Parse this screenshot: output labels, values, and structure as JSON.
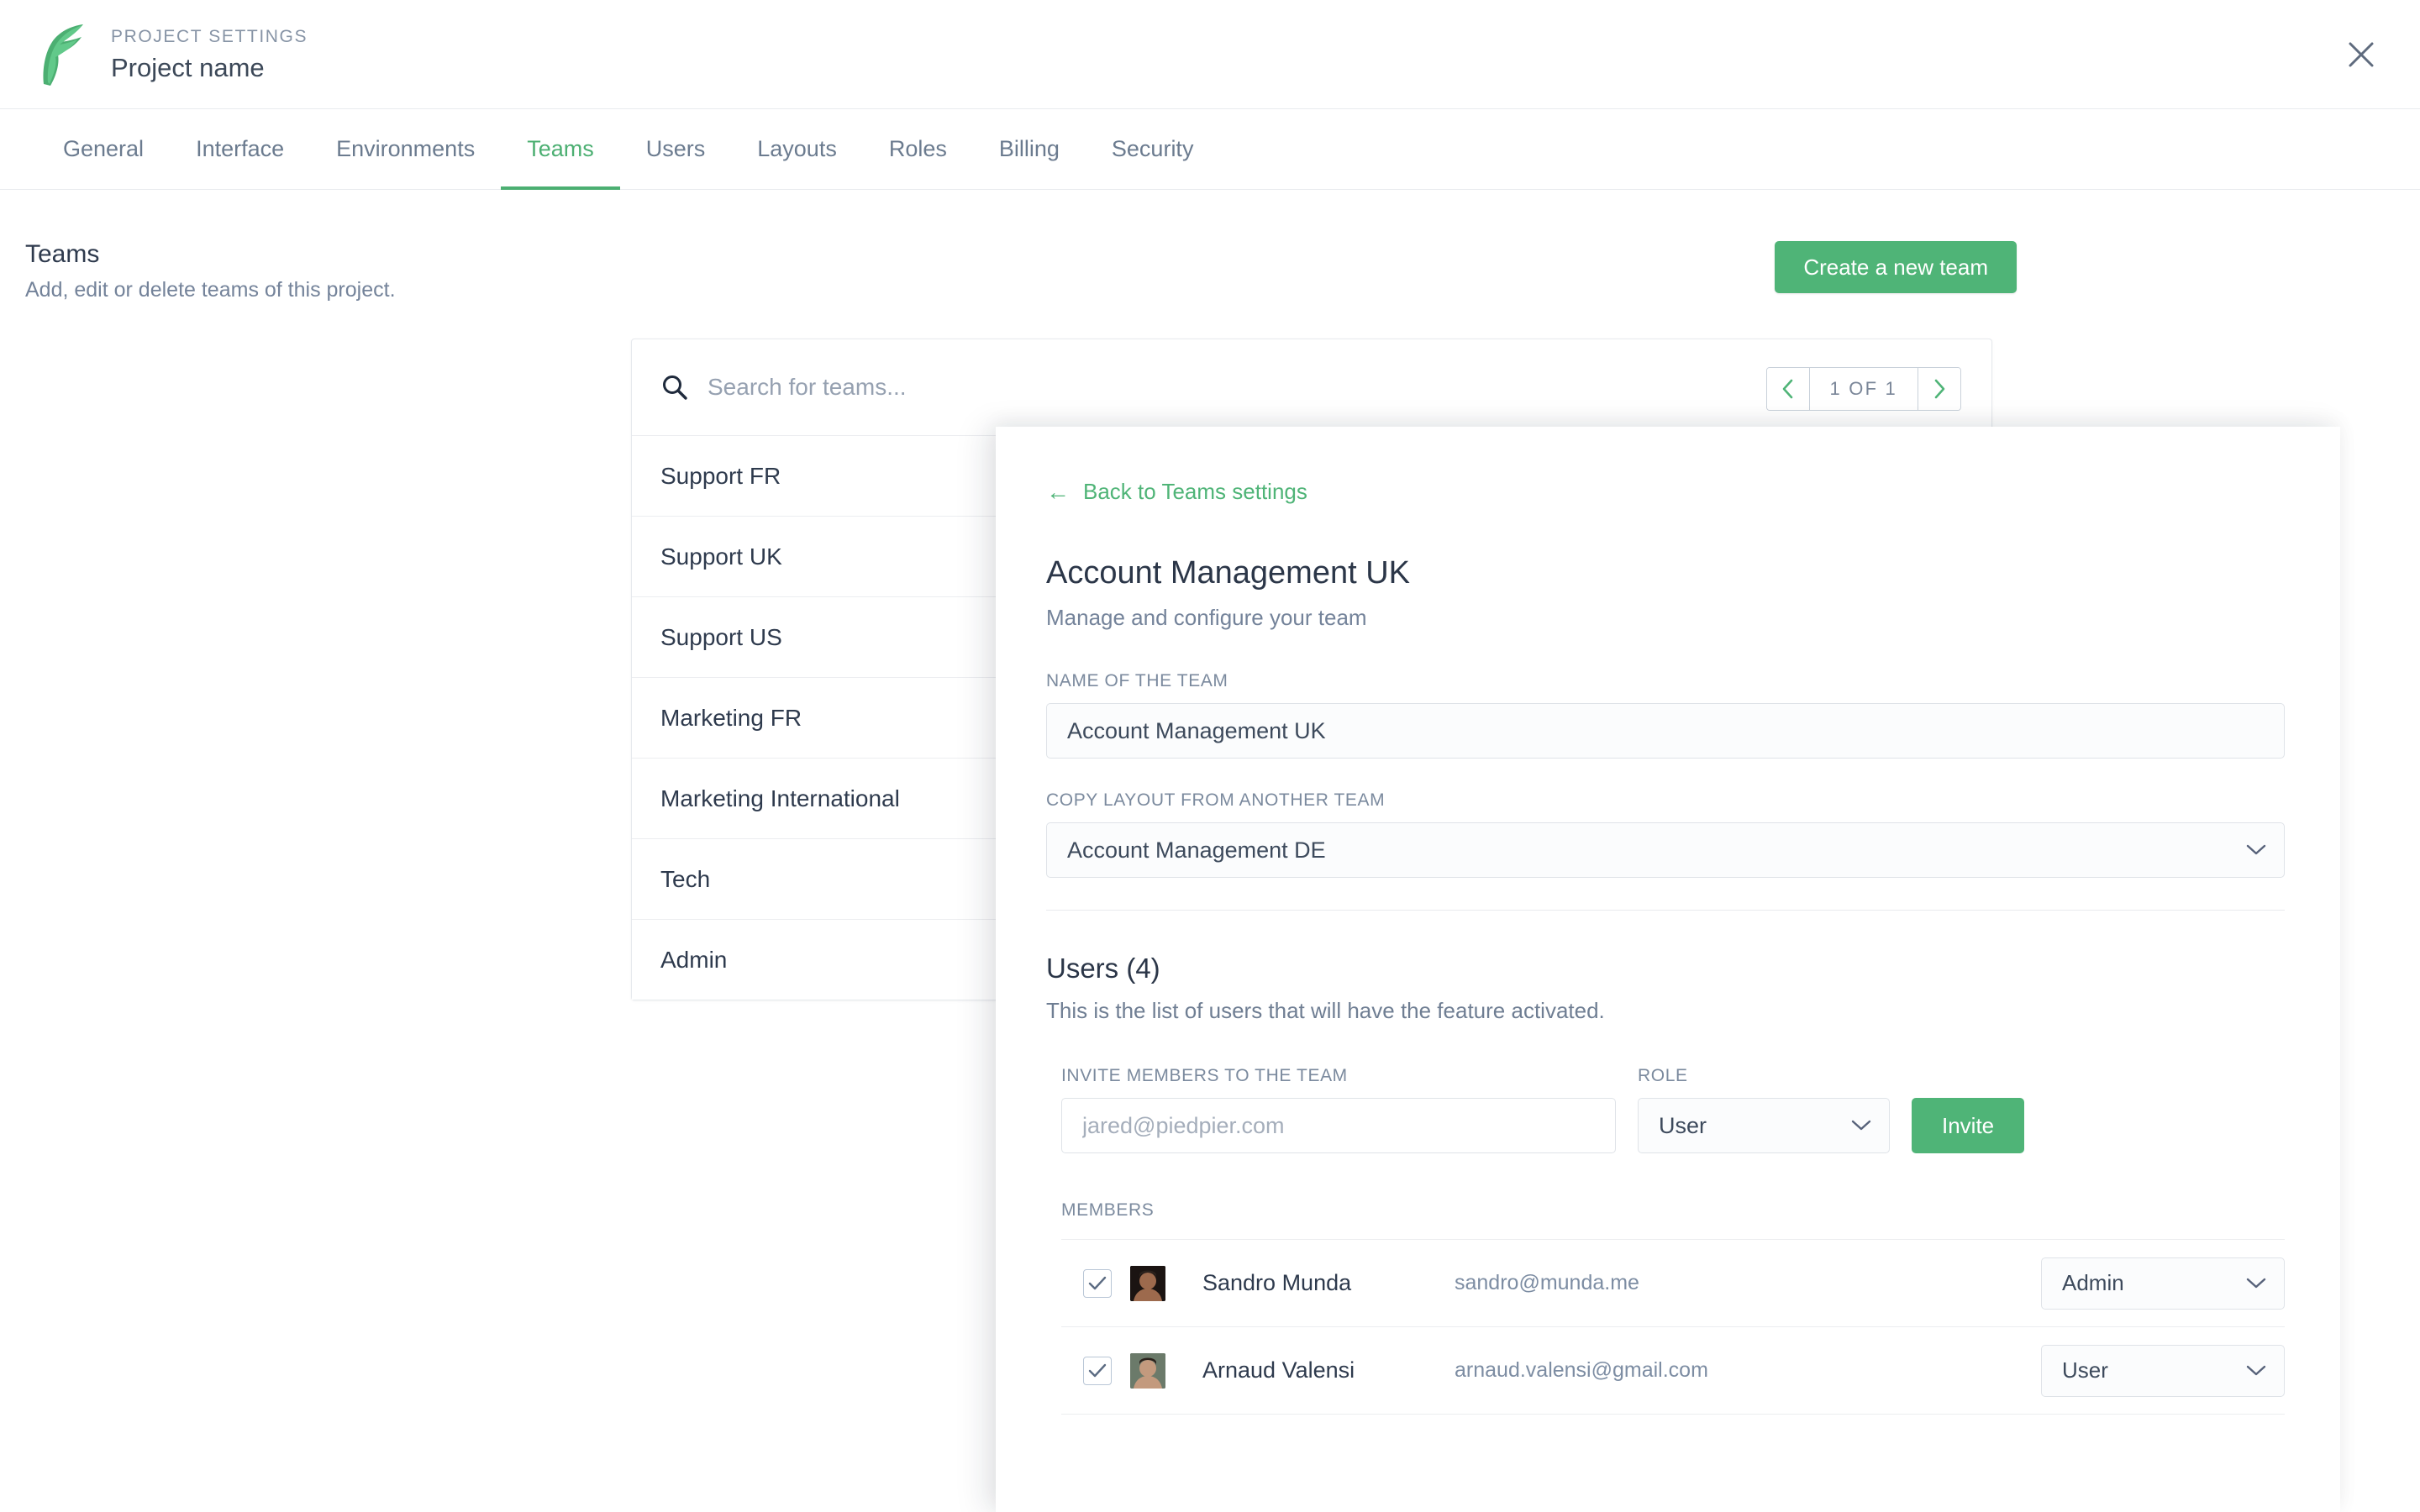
{
  "header": {
    "kicker": "PROJECT SETTINGS",
    "title": "Project name",
    "close_label": "×"
  },
  "tabs": [
    {
      "label": "General",
      "active": false
    },
    {
      "label": "Interface",
      "active": false
    },
    {
      "label": "Environments",
      "active": false
    },
    {
      "label": "Teams",
      "active": true
    },
    {
      "label": "Users",
      "active": false
    },
    {
      "label": "Layouts",
      "active": false
    },
    {
      "label": "Roles",
      "active": false
    },
    {
      "label": "Billing",
      "active": false
    },
    {
      "label": "Security",
      "active": false
    }
  ],
  "page": {
    "title": "Teams",
    "subtitle": "Add, edit or delete teams of this project.",
    "create_button": "Create a new team"
  },
  "teams_card": {
    "search_placeholder": "Search for teams...",
    "search_value": "",
    "pagination": {
      "label": "1 OF 1",
      "prev": "‹",
      "next": "›"
    },
    "items": [
      {
        "name": "Support FR"
      },
      {
        "name": "Support UK"
      },
      {
        "name": "Support US"
      },
      {
        "name": "Marketing FR"
      },
      {
        "name": "Marketing International"
      },
      {
        "name": "Tech"
      },
      {
        "name": "Admin"
      }
    ]
  },
  "detail": {
    "back_link": "Back to Teams settings",
    "back_arrow": "←",
    "title": "Account Management UK",
    "subtitle": "Manage and configure your team",
    "name_field": {
      "label": "NAME OF THE TEAM",
      "value": "Account Management UK"
    },
    "copy_layout_field": {
      "label": "COPY LAYOUT FROM ANOTHER TEAM",
      "value": "Account Management DE"
    },
    "users": {
      "title": "Users (4)",
      "subtitle": "This is the list of users that will have the feature activated.",
      "invite": {
        "email_label": "INVITE MEMBERS TO THE TEAM",
        "email_placeholder": "jared@piedpier.com",
        "email_value": "",
        "role_label": "ROLE",
        "role_value": "User",
        "button": "Invite"
      },
      "members_label": "MEMBERS",
      "members": [
        {
          "name": "Sandro Munda",
          "email": "sandro@munda.me",
          "role": "Admin",
          "checked": true,
          "avatar_bg": "#1b1412",
          "avatar_skin": "#9d6a4d"
        },
        {
          "name": "Arnaud Valensi",
          "email": "arnaud.valensi@gmail.com",
          "role": "User",
          "checked": true,
          "avatar_bg": "#6b7a6a",
          "avatar_skin": "#c39a7e"
        }
      ]
    }
  },
  "colors": {
    "accent_green": "#4fb477",
    "text_dark": "#2e3a4d",
    "text_muted": "#74839a",
    "border": "#e6e9ed"
  }
}
